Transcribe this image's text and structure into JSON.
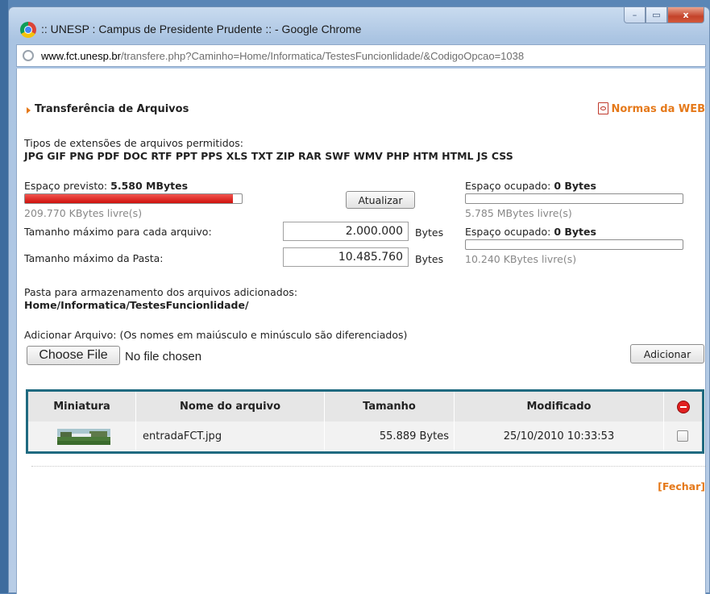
{
  "window": {
    "title": ":: UNESP : Campus de Presidente Prudente :: - Google Chrome",
    "controls": {
      "minimize": "–",
      "maximize": "▭",
      "close": "x"
    }
  },
  "address_bar": {
    "domain": "www.fct.unesp.br",
    "path": "/transfere.php?Caminho=Home/Informatica/TestesFuncionlidade/&CodigoOpcao=1038"
  },
  "page": {
    "title": "Transferência de Arquivos",
    "normas_link": "Normas da WEB",
    "extensions_label": "Tipos de extensões de arquivos permitidos:",
    "extensions_list": "JPG GIF PNG PDF DOC RTF PPT PPS XLS TXT ZIP RAR SWF WMV PHP HTM HTML JS CSS",
    "espaco_previsto_label": "Espaço previsto:",
    "espaco_previsto_value": "5.580 MBytes",
    "espaco_previsto_used_fraction": 0.96,
    "espaco_previsto_free": "209.770 KBytes livre(s)",
    "atualizar_button": "Atualizar",
    "espaco_ocupado_1_label": "Espaço ocupado:",
    "espaco_ocupado_1_value": "0 Bytes",
    "espaco_ocupado_1_used_fraction": 0,
    "espaco_ocupado_1_free": "5.785 MBytes livre(s)",
    "tamanho_arquivo_label": "Tamanho máximo para cada arquivo:",
    "tamanho_arquivo_value": "2.000.000",
    "tamanho_pasta_label": "Tamanho máximo da Pasta:",
    "tamanho_pasta_value": "10.485.760",
    "bytes_unit": "Bytes",
    "espaco_ocupado_2_label": "Espaço ocupado:",
    "espaco_ocupado_2_value": "0 Bytes",
    "espaco_ocupado_2_used_fraction": 0,
    "espaco_ocupado_2_free": "10.240 KBytes livre(s)",
    "pasta_label": "Pasta para armazenamento dos arquivos adicionados:",
    "pasta_path": "Home/Informatica/TestesFuncionlidade/",
    "adicionar_label": "Adicionar Arquivo: (Os nomes em maiúsculo e minúsculo são diferenciados)",
    "choose_file_button": "Choose File",
    "file_status": "No file chosen",
    "adicionar_button": "Adicionar",
    "fechar_link": "[Fechar]"
  },
  "file_table": {
    "headers": {
      "miniatura": "Miniatura",
      "nome": "Nome do arquivo",
      "tamanho": "Tamanho",
      "modificado": "Modificado"
    },
    "rows": [
      {
        "nome": "entradaFCT.jpg",
        "tamanho": "55.889 Bytes",
        "modificado": "25/10/2010 10:33:53"
      }
    ]
  },
  "colors": {
    "accent": "#e5791a",
    "table_border": "#1f6a80",
    "progress_red": "#d0110d"
  }
}
